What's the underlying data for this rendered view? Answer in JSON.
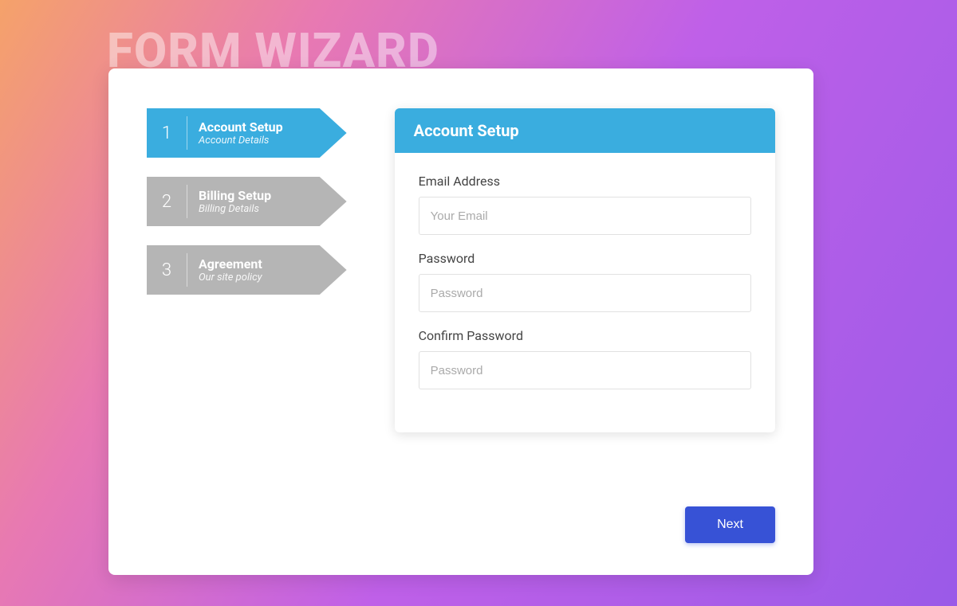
{
  "page_title": "FORM WIZARD",
  "steps": [
    {
      "num": "1",
      "title": "Account Setup",
      "sub": "Account Details",
      "active": true
    },
    {
      "num": "2",
      "title": "Billing Setup",
      "sub": "Billing Details",
      "active": false
    },
    {
      "num": "3",
      "title": "Agreement",
      "sub": "Our site policy",
      "active": false
    }
  ],
  "form": {
    "header": "Account Setup",
    "fields": {
      "email": {
        "label": "Email Address",
        "placeholder": "Your Email"
      },
      "password": {
        "label": "Password",
        "placeholder": "Password"
      },
      "confirm": {
        "label": "Confirm Password",
        "placeholder": "Password"
      }
    }
  },
  "next_label": "Next",
  "colors": {
    "active": "#3aaddf",
    "inactive": "#b5b5b5",
    "primary_btn": "#3752d6"
  }
}
